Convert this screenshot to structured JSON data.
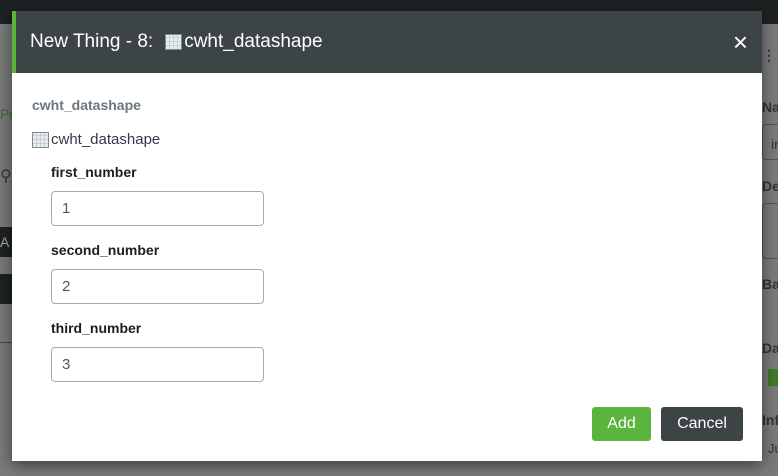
{
  "background": {
    "fragments": [
      "Pro",
      "A",
      "Na",
      "in",
      "De",
      "Ba",
      "Da",
      "Inf",
      "Ju"
    ]
  },
  "modal": {
    "title": "New Thing - 8:",
    "datashape_name": "cwht_datashape",
    "section_title": "cwht_datashape",
    "datashape_label": "cwht_datashape",
    "fields": [
      {
        "label": "first_number",
        "value": "1"
      },
      {
        "label": "second_number",
        "value": "2"
      },
      {
        "label": "third_number",
        "value": "3"
      }
    ],
    "close_icon": "×",
    "add_label": "Add",
    "cancel_label": "Cancel"
  },
  "colors": {
    "header": "#3c4446",
    "accent": "#5bb43b"
  }
}
